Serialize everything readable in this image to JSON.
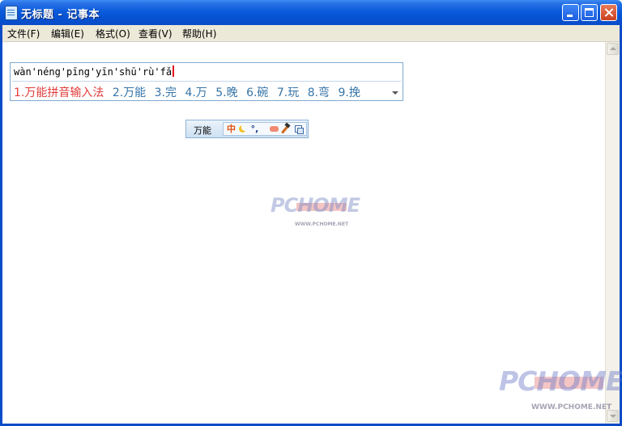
{
  "window": {
    "title": "无标题 - 记事本"
  },
  "menu": [
    "文件(F)",
    "编辑(E)",
    "格式(O)",
    "查看(V)",
    "帮助(H)"
  ],
  "ime": {
    "composition": "wàn'néng'pīng'yīn'shū'rù'fǎ",
    "candidates": [
      "1.万能拼音输入法",
      "2.万能",
      "3.完",
      "4.万",
      "5.晚",
      "6.碗",
      "7.玩",
      "8.弯",
      "9.挽"
    ],
    "selected_index": 0,
    "colors": {
      "selected": "#e23b3b",
      "candidate": "#3574a8",
      "border": "#7fa9d1"
    }
  },
  "status_bar": {
    "name": "万能",
    "icons": [
      "chinese-mode-icon",
      "half-width-moon-icon",
      "punctuation-icon",
      "soft-keyboard-icon",
      "tools-icon",
      "menu-icon"
    ],
    "mode_glyph": "中",
    "punct_glyph": "°,"
  },
  "watermarks": [
    {
      "text": "PCHOME",
      "subtext": "WWW.PCHOME.NET"
    },
    {
      "text": "PCHOME",
      "subtext": "WWW.PCHOME.NET"
    }
  ],
  "colors": {
    "titlebar": "#0a5bdc",
    "menubar": "#ece9d8",
    "editor_bg": "#ffffff"
  }
}
